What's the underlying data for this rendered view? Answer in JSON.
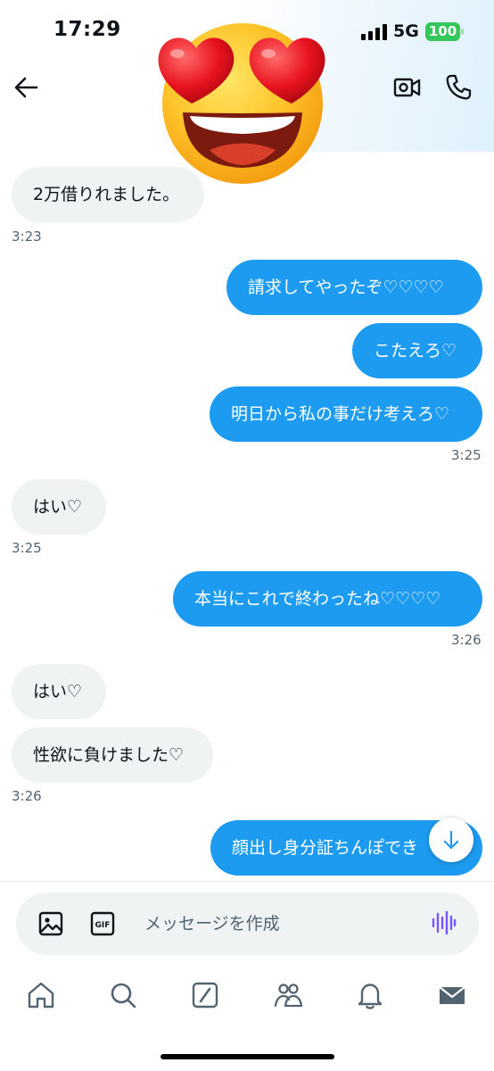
{
  "status_bar": {
    "time": "17:29",
    "network": "5G",
    "battery": "100",
    "battery_color": "#34c759"
  },
  "header": {
    "back_icon": "arrow-left-icon",
    "video_icon": "video-camera-icon",
    "call_icon": "phone-icon",
    "avatar": "heart-eyes-emoji"
  },
  "colors": {
    "outgoing_bubble": "#1d9bf0",
    "incoming_bubble": "#eff3f4",
    "timestamp": "#536471"
  },
  "messages": [
    {
      "text": "2万借りれました。",
      "direction": "in"
    },
    {
      "text": "請求してやったぞ♡♡♡♡",
      "direction": "out"
    },
    {
      "text": "こたえろ♡",
      "direction": "out"
    },
    {
      "text": "明日から私の事だけ考えろ♡",
      "direction": "out"
    },
    {
      "text": "はい♡",
      "direction": "in"
    },
    {
      "text": "本当にこれで終わったね♡♡♡♡",
      "direction": "out"
    },
    {
      "text": "はい♡",
      "direction": "in"
    },
    {
      "text": "性欲に負けました♡",
      "direction": "in"
    },
    {
      "text": "顔出し身分証ちんぽでき",
      "direction": "out"
    }
  ],
  "timestamps": [
    "3:23",
    "3:25",
    "3:25",
    "3:26",
    "3:26"
  ],
  "scroll_down_icon": "arrow-down-icon",
  "composer": {
    "placeholder": "メッセージを作成",
    "image_icon": "image-icon",
    "gif_label": "GIF",
    "voice_icon": "voice-wave-icon",
    "voice_color": "#7856ff"
  },
  "tab_bar": [
    {
      "icon": "home-icon"
    },
    {
      "icon": "search-icon"
    },
    {
      "icon": "grok-icon"
    },
    {
      "icon": "communities-icon"
    },
    {
      "icon": "bell-icon"
    },
    {
      "icon": "mail-icon",
      "active": true
    }
  ]
}
